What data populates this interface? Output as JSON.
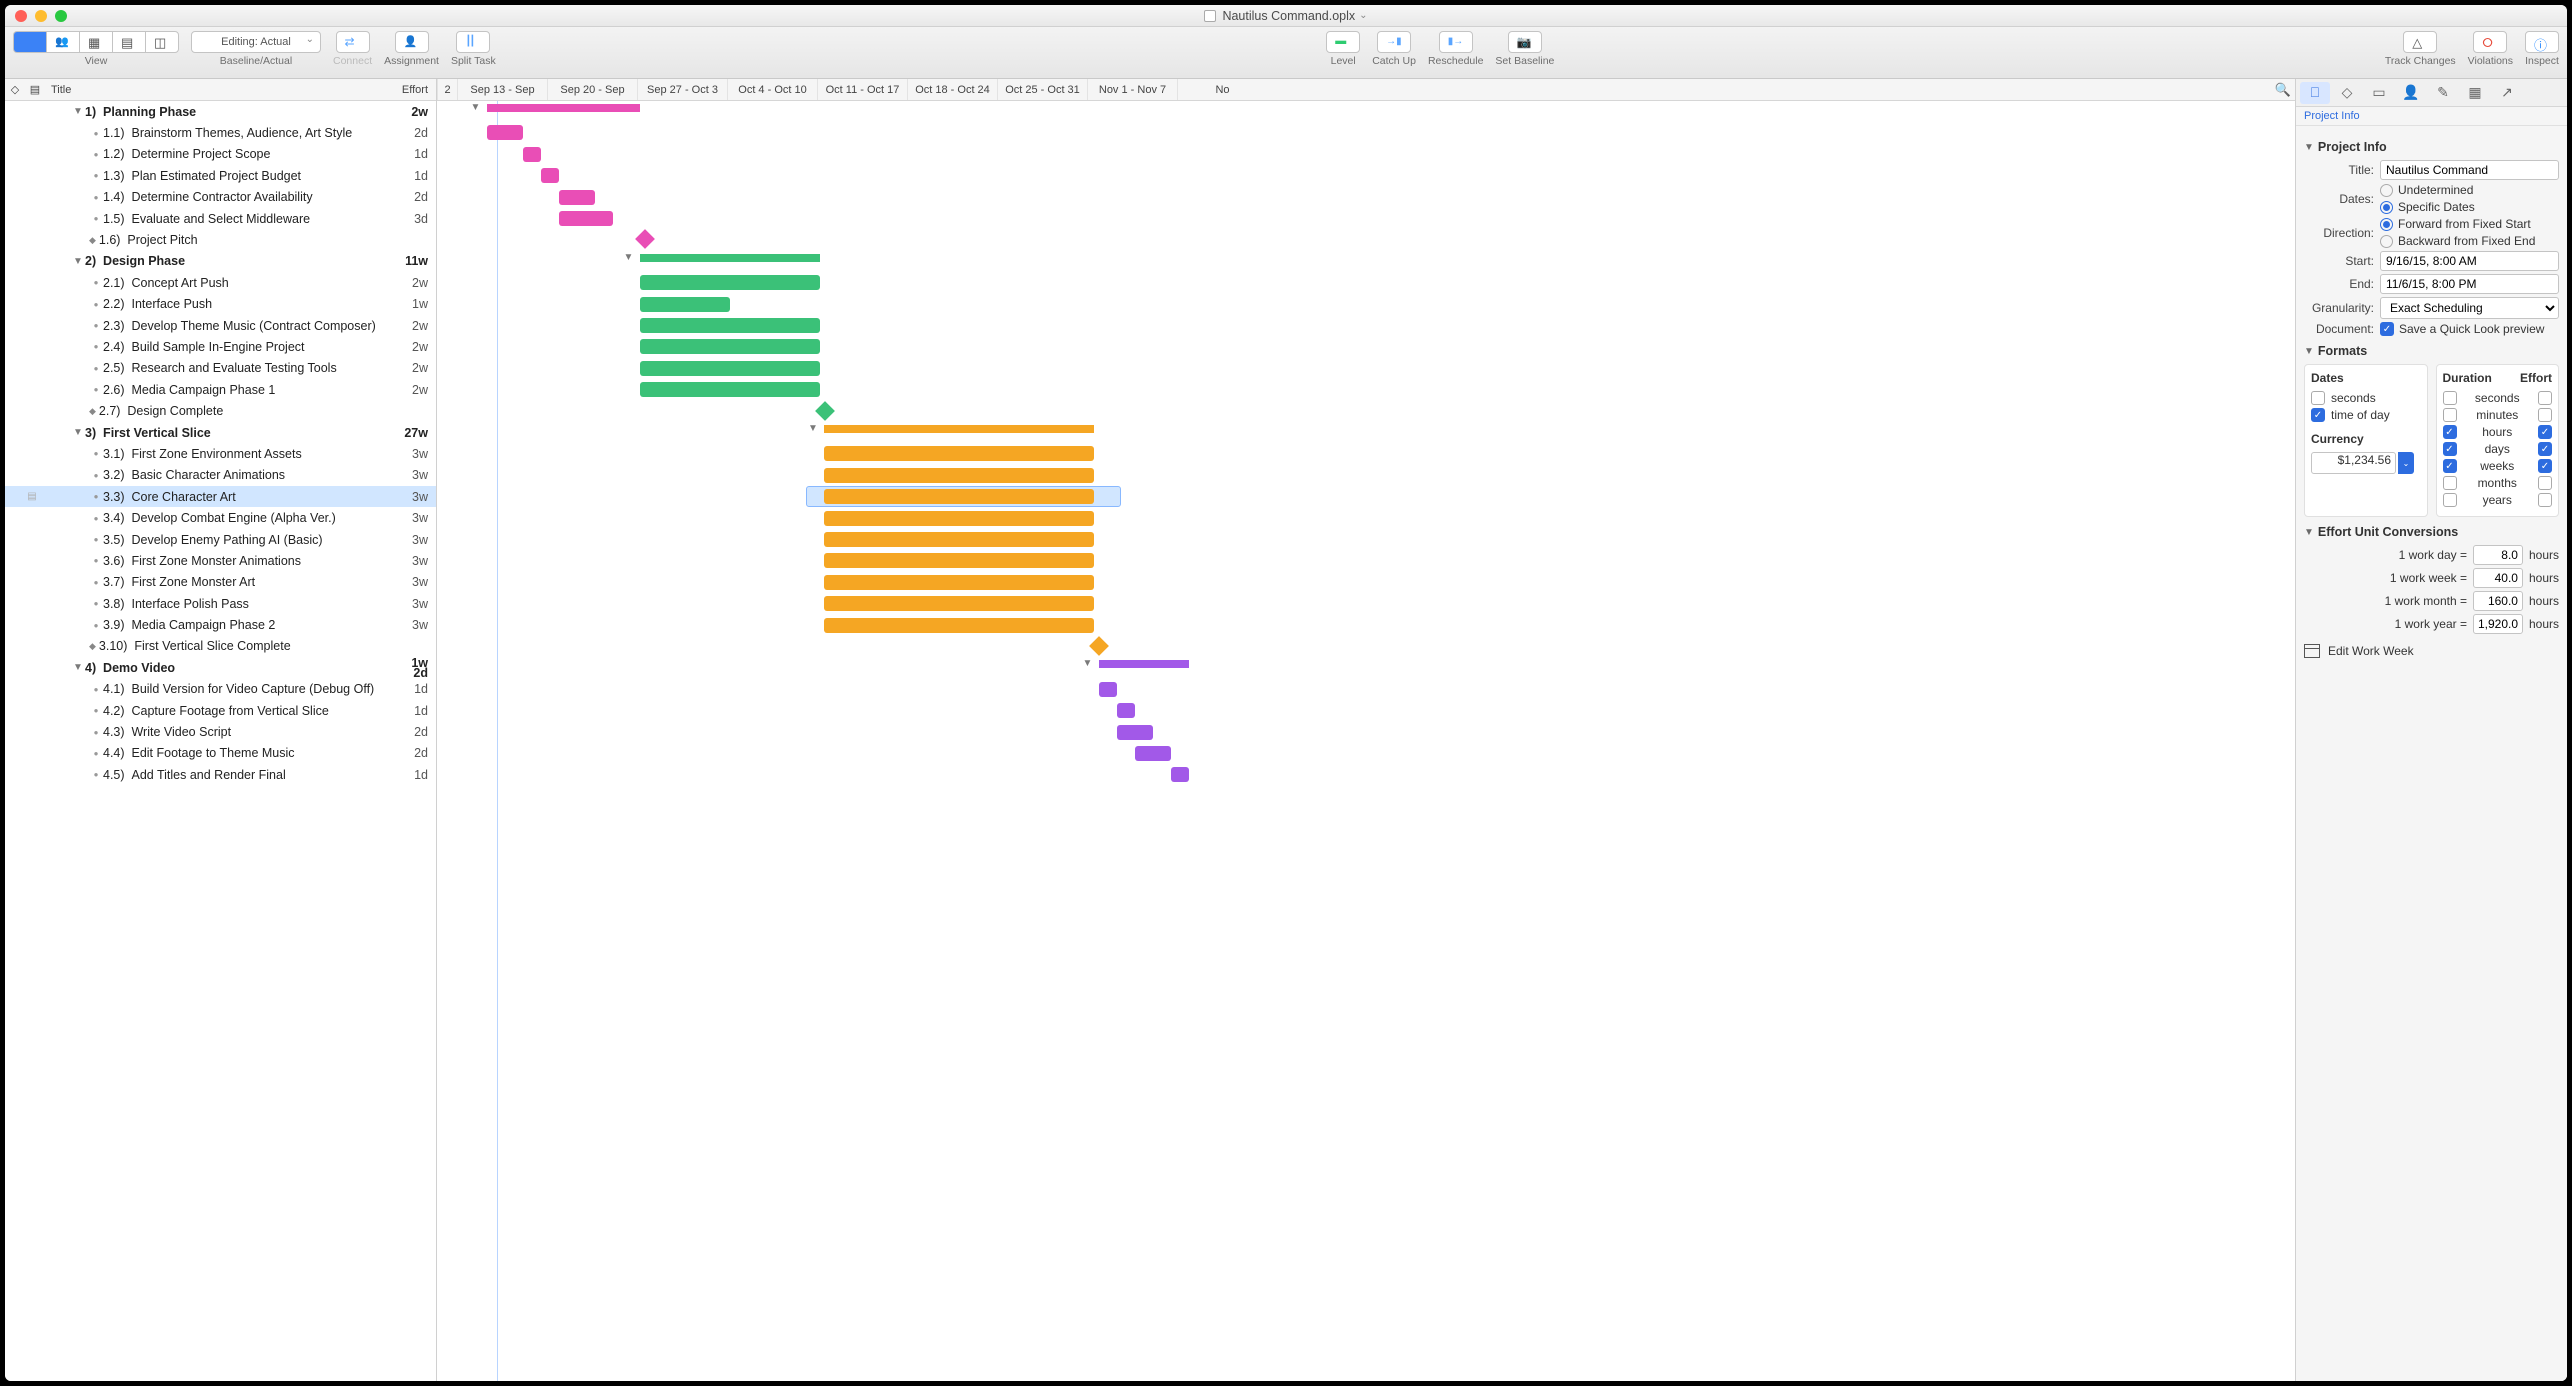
{
  "window": {
    "title": "Nautilus Command.oplx",
    "title_chevron": "⌄"
  },
  "toolbar": {
    "view_label": "View",
    "baseline_dropdown": "Editing: Actual",
    "baseline_label": "Baseline/Actual",
    "connect_label": "Connect",
    "assignment_label": "Assignment",
    "split_label": "Split Task",
    "level_label": "Level",
    "catchup_label": "Catch Up",
    "reschedule_label": "Reschedule",
    "setbaseline_label": "Set Baseline",
    "track_label": "Track Changes",
    "violations_label": "Violations",
    "inspect_label": "Inspect"
  },
  "outline_header": {
    "title": "Title",
    "effort": "Effort"
  },
  "gantt_header": {
    "cols": [
      "2",
      "Sep 13 - Sep",
      "Sep 20 - Sep",
      "Sep 27 - Oct 3",
      "Oct 4 - Oct 10",
      "Oct 11 - Oct 17",
      "Oct 18 - Oct 24",
      "Oct 25 - Oct 31",
      "Nov 1 - Nov 7",
      "No"
    ]
  },
  "tasks": [
    {
      "level": 0,
      "group": true,
      "num": "1)",
      "title": "Planning Phase",
      "effort": "2w",
      "color": "pink",
      "start": 0.55,
      "len": 1.7,
      "type": "summary"
    },
    {
      "level": 1,
      "num": "1.1)",
      "title": "Brainstorm Themes, Audience, Art Style",
      "effort": "2d",
      "color": "pink",
      "start": 0.55,
      "len": 0.4
    },
    {
      "level": 1,
      "num": "1.2)",
      "title": "Determine Project Scope",
      "effort": "1d",
      "color": "pink",
      "start": 0.95,
      "len": 0.2
    },
    {
      "level": 1,
      "num": "1.3)",
      "title": "Plan Estimated Project Budget",
      "effort": "1d",
      "color": "pink",
      "start": 1.15,
      "len": 0.2
    },
    {
      "level": 1,
      "num": "1.4)",
      "title": "Determine Contractor Availability",
      "effort": "2d",
      "color": "pink",
      "start": 1.35,
      "len": 0.4
    },
    {
      "level": 1,
      "num": "1.5)",
      "title": "Evaluate and Select Middleware",
      "effort": "3d",
      "color": "pink",
      "start": 1.35,
      "len": 0.6
    },
    {
      "level": 1,
      "milestone": true,
      "num": "1.6)",
      "title": "Project Pitch",
      "effort": "",
      "color": "pink",
      "start": 2.23,
      "type": "milestone"
    },
    {
      "level": 0,
      "group": true,
      "num": "2)",
      "title": "Design Phase",
      "effort": "11w",
      "color": "green",
      "start": 2.25,
      "len": 2.0,
      "type": "summary"
    },
    {
      "level": 1,
      "num": "2.1)",
      "title": "Concept Art Push",
      "effort": "2w",
      "color": "green",
      "start": 2.25,
      "len": 2.0
    },
    {
      "level": 1,
      "num": "2.2)",
      "title": "Interface Push",
      "effort": "1w",
      "color": "green",
      "start": 2.25,
      "len": 1.0
    },
    {
      "level": 1,
      "num": "2.3)",
      "title": "Develop Theme Music (Contract Composer)",
      "effort": "2w",
      "color": "green",
      "start": 2.25,
      "len": 2.0
    },
    {
      "level": 1,
      "num": "2.4)",
      "title": "Build Sample In-Engine Project",
      "effort": "2w",
      "color": "green",
      "start": 2.25,
      "len": 2.0
    },
    {
      "level": 1,
      "num": "2.5)",
      "title": "Research and Evaluate Testing Tools",
      "effort": "2w",
      "color": "green",
      "start": 2.25,
      "len": 2.0
    },
    {
      "level": 1,
      "num": "2.6)",
      "title": "Media Campaign Phase 1",
      "effort": "2w",
      "color": "green",
      "start": 2.25,
      "len": 2.0
    },
    {
      "level": 1,
      "milestone": true,
      "num": "2.7)",
      "title": "Design Complete",
      "effort": "",
      "color": "green",
      "start": 4.23,
      "type": "milestone"
    },
    {
      "level": 0,
      "group": true,
      "num": "3)",
      "title": "First Vertical Slice",
      "effort": "27w",
      "color": "orange",
      "start": 4.3,
      "len": 3.0,
      "type": "summary"
    },
    {
      "level": 1,
      "num": "3.1)",
      "title": "First Zone Environment Assets",
      "effort": "3w",
      "color": "orange",
      "start": 4.3,
      "len": 3.0
    },
    {
      "level": 1,
      "num": "3.2)",
      "title": "Basic Character Animations",
      "effort": "3w",
      "color": "orange",
      "start": 4.3,
      "len": 3.0
    },
    {
      "level": 1,
      "selected": true,
      "num": "3.3)",
      "title": "Core Character Art",
      "effort": "3w",
      "color": "orange",
      "start": 4.3,
      "len": 3.0
    },
    {
      "level": 1,
      "num": "3.4)",
      "title": "Develop Combat Engine (Alpha Ver.)",
      "effort": "3w",
      "color": "orange",
      "start": 4.3,
      "len": 3.0
    },
    {
      "level": 1,
      "num": "3.5)",
      "title": "Develop Enemy Pathing AI (Basic)",
      "effort": "3w",
      "color": "orange",
      "start": 4.3,
      "len": 3.0
    },
    {
      "level": 1,
      "num": "3.6)",
      "title": "First Zone Monster Animations",
      "effort": "3w",
      "color": "orange",
      "start": 4.3,
      "len": 3.0
    },
    {
      "level": 1,
      "num": "3.7)",
      "title": "First Zone Monster Art",
      "effort": "3w",
      "color": "orange",
      "start": 4.3,
      "len": 3.0
    },
    {
      "level": 1,
      "num": "3.8)",
      "title": "Interface Polish Pass",
      "effort": "3w",
      "color": "orange",
      "start": 4.3,
      "len": 3.0
    },
    {
      "level": 1,
      "num": "3.9)",
      "title": "Media Campaign Phase 2",
      "effort": "3w",
      "color": "orange",
      "start": 4.3,
      "len": 3.0
    },
    {
      "level": 1,
      "milestone": true,
      "num": "3.10)",
      "title": "First Vertical Slice Complete",
      "effort": "",
      "color": "orange",
      "start": 7.28,
      "type": "milestone"
    },
    {
      "level": 0,
      "group": true,
      "num": "4)",
      "title": "Demo Video",
      "effort": "1w 2d",
      "color": "purple",
      "start": 7.35,
      "len": 1.0,
      "type": "summary"
    },
    {
      "level": 1,
      "num": "4.1)",
      "title": "Build Version for Video Capture (Debug Off)",
      "effort": "1d",
      "color": "purple",
      "start": 7.35,
      "len": 0.2
    },
    {
      "level": 1,
      "num": "4.2)",
      "title": "Capture Footage from Vertical Slice",
      "effort": "1d",
      "color": "purple",
      "start": 7.55,
      "len": 0.2
    },
    {
      "level": 1,
      "num": "4.3)",
      "title": "Write Video Script",
      "effort": "2d",
      "color": "purple",
      "start": 7.55,
      "len": 0.4
    },
    {
      "level": 1,
      "num": "4.4)",
      "title": "Edit Footage to Theme Music",
      "effort": "2d",
      "color": "purple",
      "start": 7.75,
      "len": 0.4
    },
    {
      "level": 1,
      "num": "4.5)",
      "title": "Add Titles and Render Final",
      "effort": "1d",
      "color": "purple",
      "start": 8.15,
      "len": 0.2
    }
  ],
  "inspector": {
    "panel_title": "Project Info",
    "section_project": "Project Info",
    "title_label": "Title:",
    "title_value": "Nautilus Command",
    "dates_label": "Dates:",
    "dates_undetermined": "Undetermined",
    "dates_specific": "Specific Dates",
    "direction_label": "Direction:",
    "direction_fwd": "Forward from Fixed Start",
    "direction_bwd": "Backward from Fixed End",
    "start_label": "Start:",
    "start_value": "9/16/15, 8:00 AM",
    "end_label": "End:",
    "end_value": "11/6/15, 8:00 PM",
    "granularity_label": "Granularity:",
    "granularity_value": "Exact Scheduling",
    "document_label": "Document:",
    "quicklook": "Save a Quick Look preview",
    "section_formats": "Formats",
    "dates_hdr": "Dates",
    "duration_hdr": "Duration",
    "effort_hdr": "Effort",
    "fmt_seconds": "seconds",
    "fmt_tod": "time of day",
    "fmt_minutes": "minutes",
    "fmt_hours": "hours",
    "fmt_days": "days",
    "fmt_weeks": "weeks",
    "fmt_months": "months",
    "fmt_years": "years",
    "currency_hdr": "Currency",
    "currency_value": "$1,234.56",
    "section_conv": "Effort Unit Conversions",
    "conv_day_l": "1 work day =",
    "conv_day_v": "8.0",
    "conv_unit": "hours",
    "conv_week_l": "1 work week =",
    "conv_week_v": "40.0",
    "conv_month_l": "1 work month =",
    "conv_month_v": "160.0",
    "conv_year_l": "1 work year =",
    "conv_year_v": "1,920.0",
    "edit_ww": "Edit Work Week"
  }
}
